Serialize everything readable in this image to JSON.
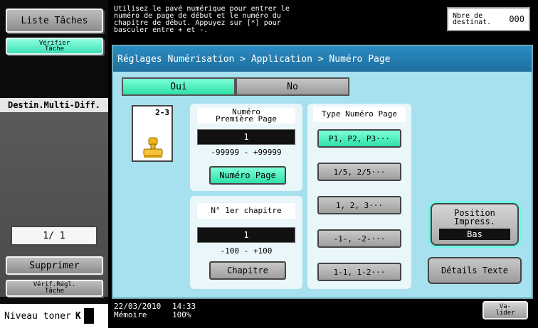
{
  "left": {
    "liste_label": "Liste Tâches",
    "verifier_label": "Vérifier\nTâche",
    "dest_multi_label": "Destin.Multi-Diff.",
    "page_count": "1/ 1",
    "supprimer_label": "Supprimer",
    "verif_regl_label": "Vérif.Régl.\nTâche",
    "toner_label": "Niveau toner",
    "toner_letter": "K"
  },
  "header": {
    "message": "Utilisez le pavé numérique pour entrer le\nnuméro de page de début et le numéro du\nchapitre de début. Appuyez sur [*] pour\nbasculer entre + et -.",
    "dest_count_label": "Nbre de\ndestinat.",
    "dest_count_value": "000"
  },
  "main": {
    "breadcrumb": "Réglages Numérisation > Application > Numéro Page",
    "toggle_oui": "Oui",
    "toggle_no": "No",
    "preview_label": "2-3",
    "first_page_title": "Numéro\nPremière Page",
    "first_page_value": "1",
    "first_page_range": "-99999  -  +99999",
    "numero_page_button": "Numéro Page",
    "chapter_title": "N° 1er chapitre",
    "chapter_value": "1",
    "chapter_range": "-100  -  +100",
    "chapitre_button": "Chapitre",
    "type_title": "Type Numéro Page",
    "type_options": [
      "P1, P2, P3···",
      "1/5, 2/5···",
      "1, 2, 3···",
      "-1-, -2-···",
      "1-1, 1-2···"
    ],
    "position_label": "Position\nImpress.",
    "position_value": "Bas",
    "details_label": "Détails Texte"
  },
  "footer": {
    "date": "22/03/2010",
    "time": "14:33",
    "memory_label": "Mémoire",
    "memory_value": "100%",
    "valider_label": "Va-\nlider"
  },
  "colors": {
    "accent_green": "#2ee0a8",
    "panel_bg": "#a7e0ee",
    "breadcrumb_bg": "#1f6f9e",
    "highlight": "#6ff6e7"
  }
}
